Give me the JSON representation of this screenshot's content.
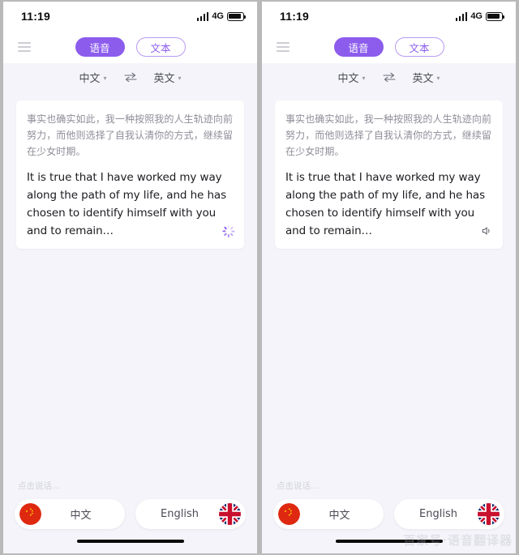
{
  "app": {
    "accent_purple": "#8C5CED",
    "accent_purple_border": "#B999F3",
    "screen_bg": "#F4F4FA",
    "card_bg": "#FFFFFF",
    "outer_bg": "#B9B9B9"
  },
  "status_bar": {
    "time": "11:19",
    "network": "4G",
    "signal_icon": "signal-bars-icon",
    "battery_icon": "battery-full-icon"
  },
  "top_nav": {
    "menu_icon": "hamburger-menu-icon",
    "tabs": [
      {
        "label": "语音",
        "active": true
      },
      {
        "label": "文本",
        "active": false
      }
    ]
  },
  "language_bar": {
    "source": "中文",
    "target": "英文",
    "caret_icon": "chevron-down-icon",
    "swap_icon": "swap-arrows-icon"
  },
  "card": {
    "source_text": "事实也确实如此，我一种按照我的人生轨迹向前努力，而他则选择了自我认清你的方式，继续留在少女时期。",
    "translated_text": "It is true that I have worked my way along the path of my life, and he has chosen to identify himself with you and to remain…",
    "left_trailing_icon": "loading-spinner-icon",
    "right_trailing_icon": "speaker-icon"
  },
  "footer": {
    "hint": "点击说话...",
    "buttons": [
      {
        "label": "中文",
        "flag_icon": "china-flag-icon",
        "flag_side": "left"
      },
      {
        "label": "English",
        "flag_icon": "uk-flag-icon",
        "flag_side": "right"
      }
    ]
  },
  "home_indicator": "home-indicator-bar",
  "watermark": "百家号·语音翻译器"
}
